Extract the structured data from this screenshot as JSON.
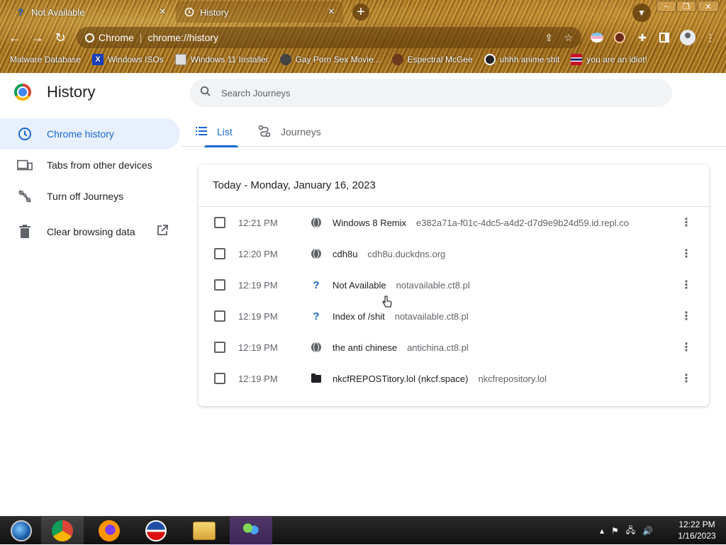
{
  "tabs": [
    {
      "title": "Not Available",
      "favicon": "question-icon",
      "close": "×"
    },
    {
      "title": "History",
      "favicon": "history-clock-icon",
      "close": "×"
    }
  ],
  "new_tab": "+",
  "window_controls": {
    "minimize": "–",
    "maximize": "❐",
    "close": "✕"
  },
  "omnibox": {
    "site": "Chrome",
    "url": "chrome://history"
  },
  "bookmarks": [
    {
      "label": "Malware Database",
      "icon": "none"
    },
    {
      "label": "Windows ISOs",
      "icon": "x-icon"
    },
    {
      "label": "Windows 11 Installer",
      "icon": "image-icon"
    },
    {
      "label": "Gay Porn Sex Movie...",
      "icon": "globe-icon"
    },
    {
      "label": "Espectral McGee",
      "icon": "avatar-icon"
    },
    {
      "label": "uhhh anime shit",
      "icon": "avatar-icon"
    },
    {
      "label": "you are an idiot!",
      "icon": "flag-icon"
    }
  ],
  "page": {
    "title": "History",
    "search_placeholder": "Search Journeys"
  },
  "sidebar": {
    "items": [
      {
        "label": "Chrome history",
        "icon": "clock-icon",
        "active": true
      },
      {
        "label": "Tabs from other devices",
        "icon": "devices-icon",
        "active": false
      },
      {
        "label": "Turn off Journeys",
        "icon": "journeys-off-icon",
        "active": false
      },
      {
        "label": "Clear browsing data",
        "icon": "trash-icon",
        "active": false
      }
    ]
  },
  "history_tabs": [
    {
      "label": "List",
      "active": true
    },
    {
      "label": "Journeys",
      "active": false
    }
  ],
  "card": {
    "header": "Today - Monday, January 16, 2023",
    "rows": [
      {
        "time": "12:21 PM",
        "favicon": "globe",
        "title": "Windows 8 Remix",
        "domain": "e382a71a-f01c-4dc5-a4d2-d7d9e9b24d59.id.repl.co"
      },
      {
        "time": "12:20 PM",
        "favicon": "globe",
        "title": "cdh8u",
        "domain": "cdh8u.duckdns.org"
      },
      {
        "time": "12:19 PM",
        "favicon": "question",
        "title": "Not Available",
        "domain": "notavailable.ct8.pl"
      },
      {
        "time": "12:19 PM",
        "favicon": "question",
        "title": "Index of /shit",
        "domain": "notavailable.ct8.pl"
      },
      {
        "time": "12:19 PM",
        "favicon": "globe",
        "title": "the anti chinese",
        "domain": "antichina.ct8.pl"
      },
      {
        "time": "12:19 PM",
        "favicon": "folder",
        "title": "nkcfREPOSTitory.lol (nkcf.space)",
        "domain": "nkcfrepository.lol"
      }
    ]
  },
  "taskbar": {
    "clock_time": "12:22 PM",
    "clock_date": "1/16/2023"
  },
  "colors": {
    "accent": "#1967d2",
    "active_bg": "#e8f0fe"
  }
}
